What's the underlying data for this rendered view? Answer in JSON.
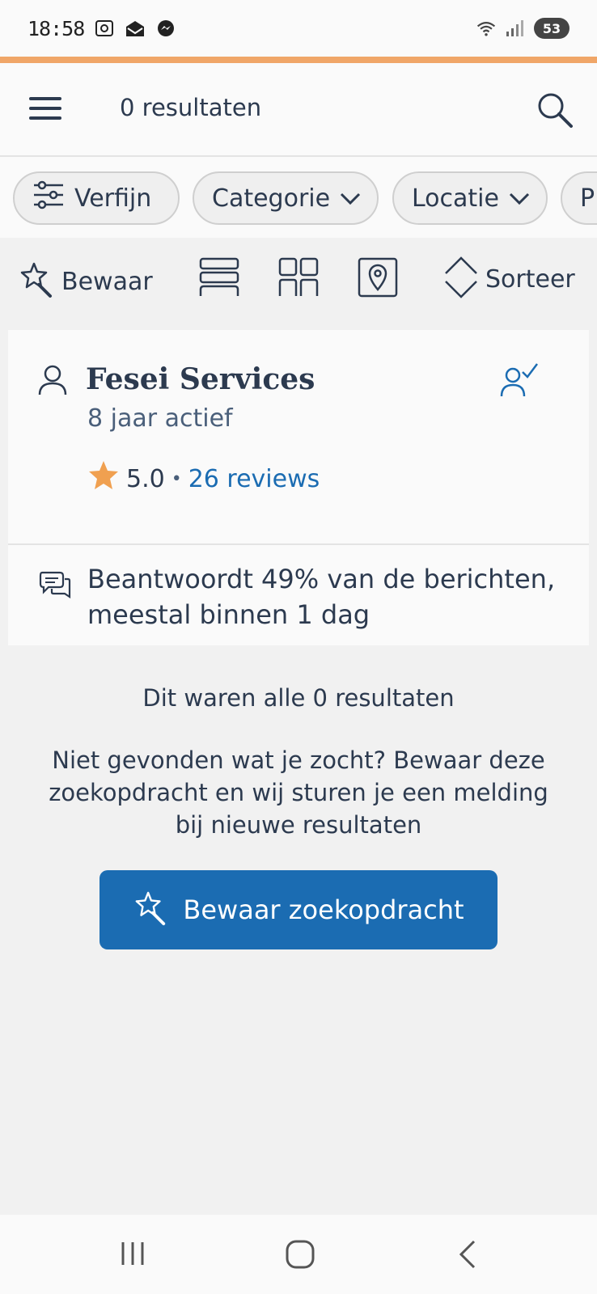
{
  "status_bar": {
    "time": "18:58",
    "battery": "53",
    "icons": [
      "screenshot-icon",
      "mail-icon",
      "messenger-icon",
      "wifi-icon",
      "signal-icon",
      "battery-icon"
    ]
  },
  "header": {
    "title": "0 resultaten",
    "menu_icon": "hamburger-menu-icon",
    "search_icon": "search-icon"
  },
  "filters": {
    "chips": [
      {
        "label": "Verfijn",
        "icon": "sliders-icon"
      },
      {
        "label": "Categorie",
        "icon": "chevron-down-icon"
      },
      {
        "label": "Locatie",
        "icon": "chevron-down-icon"
      },
      {
        "label": "P",
        "icon": ""
      }
    ]
  },
  "toolbar": {
    "save_label": "Bewaar",
    "sort_label": "Sorteer",
    "view_icons": [
      "list-view-icon",
      "grid-view-icon",
      "map-view-icon"
    ]
  },
  "result": {
    "name": "Fesei Services",
    "active": "8 jaar actief",
    "score": "5.0",
    "separator": "•",
    "reviews": "26 reviews",
    "response": "Beantwoordt 49% van de berichten, meestal binnen 1 dag"
  },
  "footer": {
    "end_text": "Dit waren alle 0 resultaten",
    "hint_text": "Niet gevonden wat je zocht? Bewaar deze zoekopdracht en wij sturen je een melding bij nieuwe resultaten",
    "save_search_label": "Bewaar zoekopdracht"
  },
  "colors": {
    "accent": "#1b6cb2",
    "brand_orange": "#f0a668",
    "text": "#2c3a4f",
    "star": "#f0a050"
  }
}
